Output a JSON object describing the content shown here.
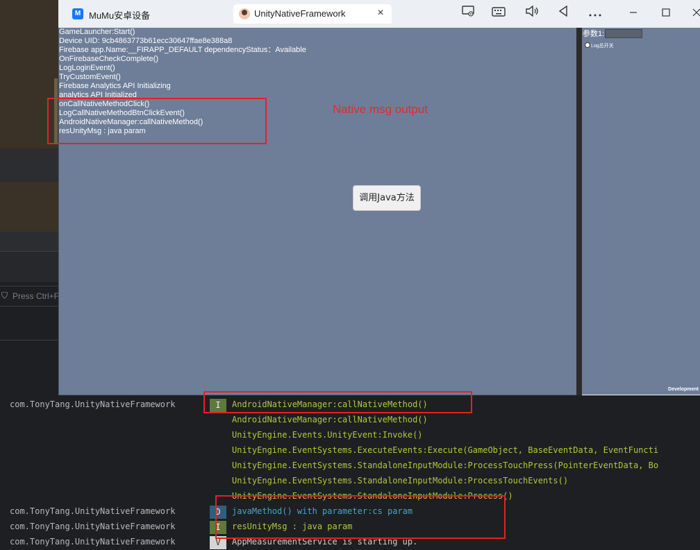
{
  "ide": {
    "filter_icon": "filter-icon",
    "filter_placeholder": "Press Ctrl+F"
  },
  "emulator": {
    "tabs": [
      {
        "label": "MuMu安卓设备",
        "icon": "mumu-logo-icon"
      },
      {
        "label": "UnityNativeFramework",
        "icon": "app-avatar-icon"
      }
    ],
    "mumu_logo_text": "M",
    "toolbar_icons": [
      "screen-record-icon",
      "keyboard-icon",
      "volume-icon",
      "back-icon",
      "more-icon",
      "minimize-icon",
      "maximize-icon",
      "close-icon"
    ],
    "close_tab": "×"
  },
  "game": {
    "log_lines": [
      "GameLauncher:Start()",
      "Device UID: 9cb4863773b61ecc30647ffae8e388a8",
      "Firebase app.Name:__FIRAPP_DEFAULT dependencyStatus：Available",
      "OnFirebaseCheckComplete()",
      "LogLoginEvent()",
      "TryCustomEvent()",
      "Firebase Analytics API Initializing",
      "analytics API Initialized",
      "onCallNativeMethodClick()",
      "LogCallNativeMethodBtnClickEvent()",
      "AndroidNativeManager:callNativeMethod()",
      "resUnityMsg : java param"
    ],
    "annotation": "Native msg output",
    "call_button_label": "调用Java方法"
  },
  "side_panel": {
    "param_label": "参数1:",
    "log_toggle_label": "Log总开关",
    "dev_build_label": "Development"
  },
  "logcat": {
    "rows": [
      {
        "pkg": "com.TonyTang.UnityNativeFramework",
        "level": "I",
        "msg": "AndroidNativeManager:callNativeMethod()",
        "kind": "info"
      },
      {
        "pkg": "",
        "level": "",
        "msg": "AndroidNativeManager:callNativeMethod()",
        "kind": "info"
      },
      {
        "pkg": "",
        "level": "",
        "msg": "UnityEngine.Events.UnityEvent:Invoke()",
        "kind": "info"
      },
      {
        "pkg": "",
        "level": "",
        "msg": "UnityEngine.EventSystems.ExecuteEvents:Execute(GameObject, BaseEventData, EventFuncti",
        "kind": "info"
      },
      {
        "pkg": "",
        "level": "",
        "msg": "UnityEngine.EventSystems.StandaloneInputModule:ProcessTouchPress(PointerEventData, Bo",
        "kind": "info"
      },
      {
        "pkg": "",
        "level": "",
        "msg": "UnityEngine.EventSystems.StandaloneInputModule:ProcessTouchEvents()",
        "kind": "info"
      },
      {
        "pkg": "",
        "level": "",
        "msg": "UnityEngine.EventSystems.StandaloneInputModule:Process()",
        "kind": "info"
      },
      {
        "pkg": "com.TonyTang.UnityNativeFramework",
        "level": "D",
        "msg": "javaMethod() with parameter:cs param",
        "kind": "debug"
      },
      {
        "pkg": "com.TonyTang.UnityNativeFramework",
        "level": "I",
        "msg": "resUnityMsg : java param",
        "kind": "info"
      },
      {
        "pkg": "com.TonyTang.UnityNativeFramework",
        "level": "V",
        "msg": "AppMeasurementService is starting up.",
        "kind": "verbose"
      }
    ]
  }
}
